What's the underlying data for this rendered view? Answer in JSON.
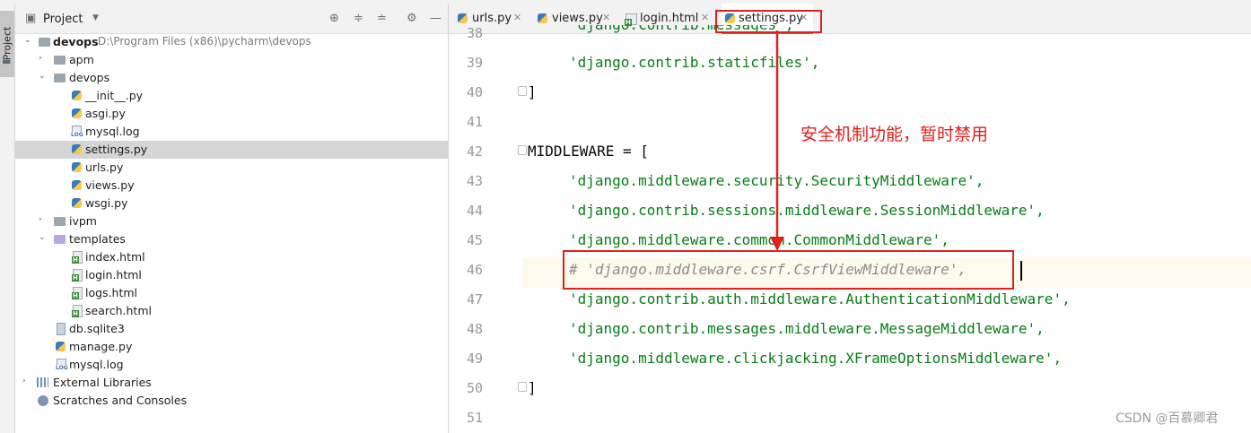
{
  "project_panel": {
    "title": "Project",
    "tree": [
      {
        "name": "devops",
        "path": "D:\\Program Files (x86)\\pycharm\\devops",
        "type": "folder",
        "expanded": true
      },
      {
        "name": "apm",
        "type": "folder"
      },
      {
        "name": "devops",
        "type": "folder",
        "expanded": true
      },
      {
        "name": "__init__.py",
        "type": "py"
      },
      {
        "name": "asgi.py",
        "type": "py"
      },
      {
        "name": "mysql.log",
        "type": "log"
      },
      {
        "name": "settings.py",
        "type": "py",
        "selected": true
      },
      {
        "name": "urls.py",
        "type": "py"
      },
      {
        "name": "views.py",
        "type": "py"
      },
      {
        "name": "wsgi.py",
        "type": "py"
      },
      {
        "name": "ivpm",
        "type": "folder"
      },
      {
        "name": "templates",
        "type": "folder",
        "expanded": true
      },
      {
        "name": "index.html",
        "type": "html"
      },
      {
        "name": "login.html",
        "type": "html"
      },
      {
        "name": "logs.html",
        "type": "html"
      },
      {
        "name": "search.html",
        "type": "html"
      },
      {
        "name": "db.sqlite3",
        "type": "db"
      },
      {
        "name": "manage.py",
        "type": "py"
      },
      {
        "name": "mysql.log",
        "type": "log"
      },
      {
        "name": "External Libraries",
        "type": "lib"
      },
      {
        "name": "Scratches and Consoles",
        "type": "scratch"
      }
    ]
  },
  "tool_stripe": {
    "label": "Project"
  },
  "tabs": [
    {
      "label": "urls.py",
      "icon": "python-file-icon"
    },
    {
      "label": "views.py",
      "icon": "python-file-icon"
    },
    {
      "label": "login.html",
      "icon": "html-file-icon"
    },
    {
      "label": "settings.py",
      "icon": "python-file-icon",
      "active": true
    }
  ],
  "editor": {
    "lines": [
      {
        "num": "38",
        "text": "'django.contrib.messages',"
      },
      {
        "num": "39",
        "text": "'django.contrib.staticfiles',"
      },
      {
        "num": "40",
        "text": "]"
      },
      {
        "num": "41",
        "text": ""
      },
      {
        "num": "42",
        "text": "MIDDLEWARE = ["
      },
      {
        "num": "43",
        "text": "'django.middleware.security.SecurityMiddleware',"
      },
      {
        "num": "44",
        "text": "'django.contrib.sessions.middleware.SessionMiddleware',"
      },
      {
        "num": "45",
        "text": "'django.middleware.common.CommonMiddleware',"
      },
      {
        "num": "46",
        "text": "# 'django.middleware.csrf.CsrfViewMiddleware',"
      },
      {
        "num": "47",
        "text": "'django.contrib.auth.middleware.AuthenticationMiddleware',"
      },
      {
        "num": "48",
        "text": "'django.contrib.messages.middleware.MessageMiddleware',"
      },
      {
        "num": "49",
        "text": "'django.middleware.clickjacking.XFrameOptionsMiddleware',"
      },
      {
        "num": "50",
        "text": "]"
      },
      {
        "num": "51",
        "text": ""
      }
    ],
    "current_line": "46"
  },
  "annotation": {
    "text": "安全机制功能，暂时禁用",
    "color": "#e0201c"
  },
  "watermark": "CSDN @百慕卿君",
  "colors": {
    "string": "#067d17",
    "comment": "#8c8c8c",
    "selection": "#d5d5d5",
    "annotation": "#e0201c"
  }
}
